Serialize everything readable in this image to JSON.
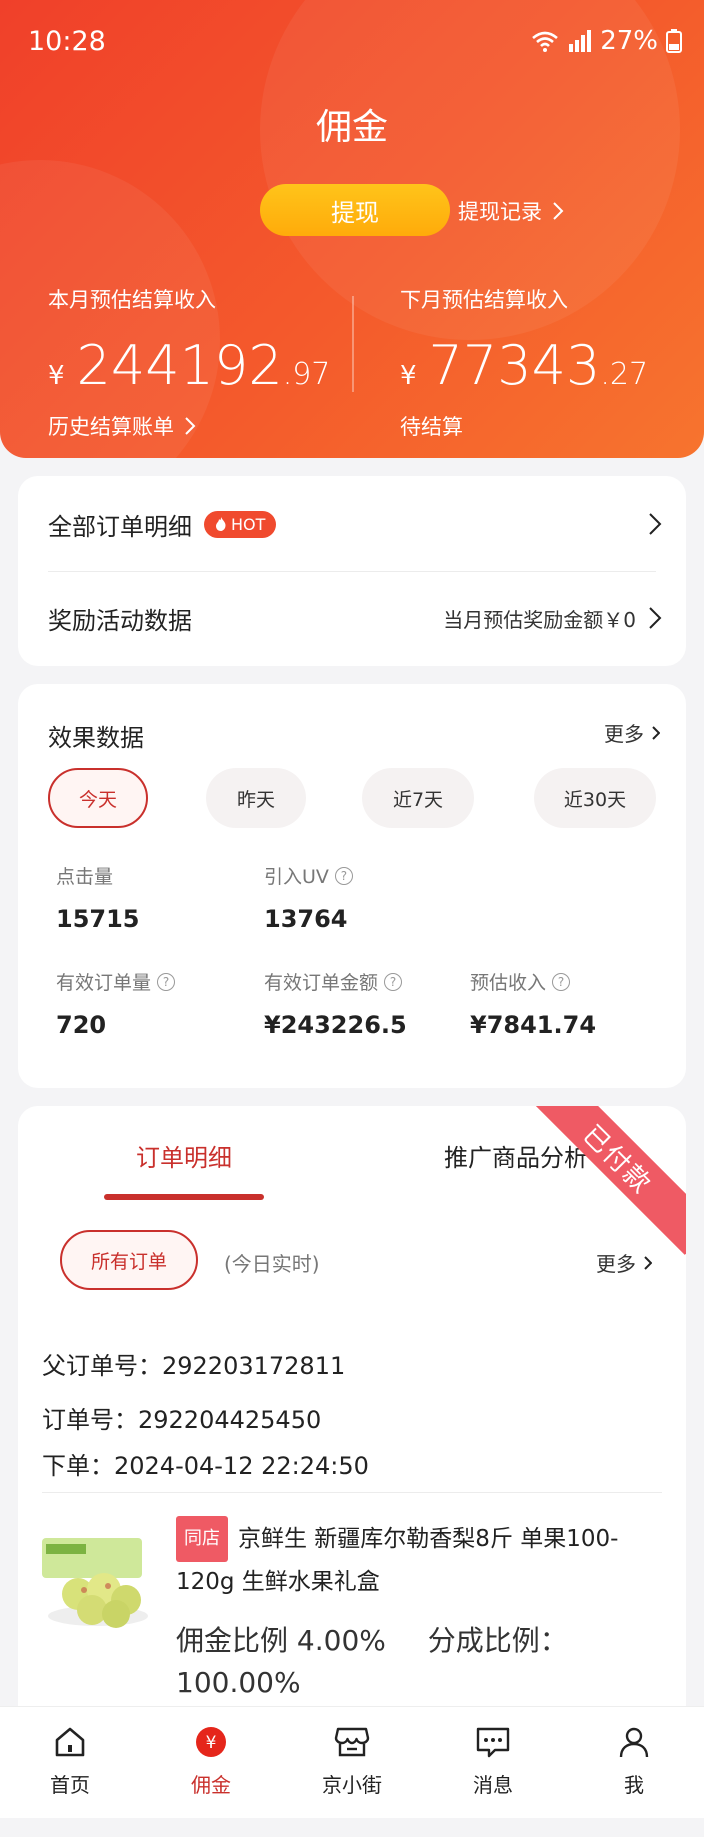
{
  "status_bar": {
    "time": "10:28",
    "battery": "27%"
  },
  "header": {
    "title": "佣金",
    "withdraw_label": "提现",
    "withdraw_record_label": "提现记录",
    "this_month": {
      "label": "本月预估结算收入",
      "currency": "¥",
      "amount_int": "244192",
      "amount_dec": ".97",
      "link": "历史结算账单"
    },
    "next_month": {
      "label": "下月预估结算收入",
      "currency": "¥",
      "amount_int": "77343",
      "amount_dec": ".27",
      "link": "待结算"
    }
  },
  "menu": {
    "all_orders": {
      "label": "全部订单明细",
      "badge": "HOT"
    },
    "reward": {
      "label": "奖励活动数据",
      "right_text": "当月预估奖励金额￥0"
    }
  },
  "effect": {
    "title": "效果数据",
    "more": "更多",
    "ranges": [
      "今天",
      "昨天",
      "近7天",
      "近30天"
    ],
    "active_range": "今天",
    "metrics": [
      {
        "label": "点击量",
        "value": "15715",
        "help": false
      },
      {
        "label": "引入UV",
        "value": "13764",
        "help": true
      },
      {
        "label": "有效订单量",
        "value": "720",
        "help": true
      },
      {
        "label": "有效订单金额",
        "value": "¥243226.5",
        "help": true
      },
      {
        "label": "预估收入",
        "value": "¥7841.74",
        "help": true
      }
    ]
  },
  "orders": {
    "tabs": [
      "订单明细",
      "推广商品分析"
    ],
    "active_tab": "订单明细",
    "filter_label": "所有订单",
    "realtime_note": "(今日实时)",
    "more": "更多",
    "status_ribbon": "已付款",
    "parent_order": "父订单号：292203172811",
    "order_no": "订单号：292204425450",
    "order_time": "下单：2024-04-12 22:24:50",
    "product": {
      "shop_tag": "同店",
      "title": "京鲜生 新疆库尔勒香梨8斤 单果100-120g 生鲜水果礼盒",
      "commission_label": "佣金比例",
      "commission_value": "4.00%",
      "share_label": "分成比例：",
      "share_value": "100.00%"
    }
  },
  "bottom_nav": [
    {
      "label": "首页",
      "icon": "home-icon"
    },
    {
      "label": "佣金",
      "icon": "yen-icon",
      "active": true
    },
    {
      "label": "京小街",
      "icon": "shop-icon"
    },
    {
      "label": "消息",
      "icon": "message-icon"
    },
    {
      "label": "我",
      "icon": "user-icon"
    }
  ],
  "colors": {
    "header_red": "#f0402a",
    "accent_red": "#c9302c",
    "gold_button": "#ffb811"
  }
}
